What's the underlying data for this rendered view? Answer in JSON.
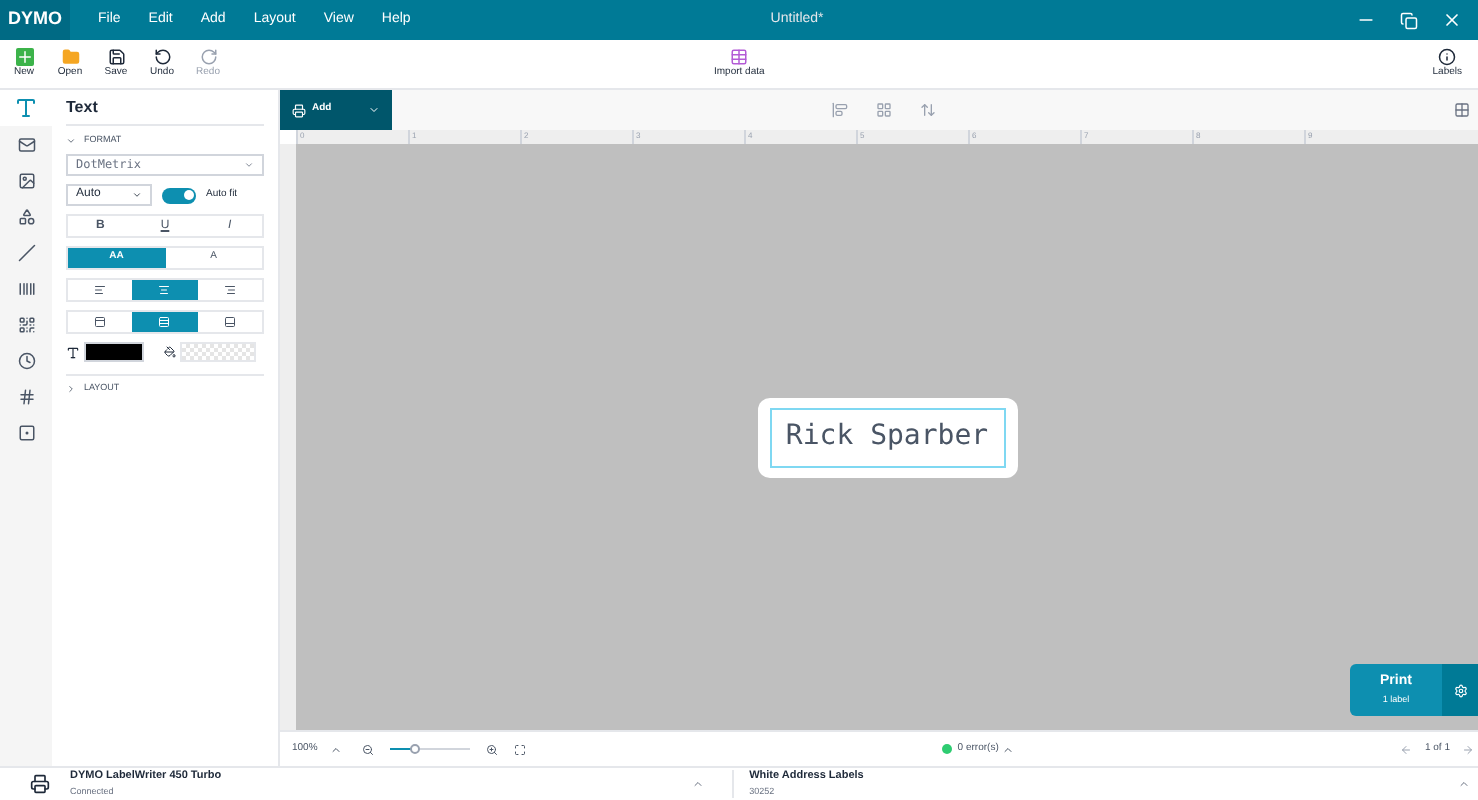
{
  "titlebar": {
    "logo": "DYMO",
    "menu": [
      "File",
      "Edit",
      "Add",
      "Layout",
      "View",
      "Help"
    ],
    "title": "Untitled*"
  },
  "toolbar": {
    "left": [
      {
        "kind": "new",
        "label": "New",
        "disabled": false
      },
      {
        "kind": "open",
        "label": "Open",
        "disabled": false
      },
      {
        "kind": "save",
        "label": "Save",
        "disabled": false
      },
      {
        "kind": "undo",
        "label": "Undo",
        "disabled": false
      },
      {
        "kind": "redo",
        "label": "Redo",
        "disabled": true
      }
    ],
    "import": "Import data",
    "labels": "Labels"
  },
  "tools": [
    {
      "kind": "text",
      "selected": true
    },
    {
      "kind": "address",
      "selected": false
    },
    {
      "kind": "image",
      "selected": false
    },
    {
      "kind": "shape",
      "selected": false
    },
    {
      "kind": "line",
      "selected": false
    },
    {
      "kind": "barcode",
      "selected": false
    },
    {
      "kind": "qr",
      "selected": false
    },
    {
      "kind": "clock",
      "selected": false
    },
    {
      "kind": "counter",
      "selected": false
    },
    {
      "kind": "frame",
      "selected": false
    }
  ],
  "panel": {
    "title": "Text",
    "format_section": {
      "label": "FORMAT",
      "expanded": true
    },
    "font": "DotMetrix",
    "size": "Auto",
    "autofit": {
      "label": "Auto fit",
      "on": true
    },
    "style_buttons": [
      {
        "label": "B",
        "kind": "bold",
        "selected": false
      },
      {
        "label": "U",
        "kind": "underline",
        "selected": false
      },
      {
        "label": "I",
        "kind": "italic",
        "selected": false
      }
    ],
    "case_buttons": [
      {
        "label": "AA",
        "kind": "upper",
        "selected": true
      },
      {
        "label": "A",
        "kind": "vertical",
        "selected": false
      }
    ],
    "halign": [
      {
        "kind": "left",
        "selected": false
      },
      {
        "kind": "center",
        "selected": true
      },
      {
        "kind": "right",
        "selected": false
      }
    ],
    "valign": [
      {
        "kind": "top",
        "selected": false
      },
      {
        "kind": "middle",
        "selected": true
      },
      {
        "kind": "bottom",
        "selected": false
      }
    ],
    "layout_section": {
      "label": "LAYOUT",
      "expanded": false
    }
  },
  "canvas": {
    "add_button": "Add",
    "label_text": "Rick Sparber",
    "ruler": [
      "0",
      "1",
      "2",
      "3",
      "4",
      "5",
      "6",
      "7",
      "8",
      "9"
    ]
  },
  "canvas_footer": {
    "zoom": "100%",
    "zoom_slider": {
      "level": 0.3
    },
    "errors": "0 error(s)",
    "pages": "1 of 1"
  },
  "print": {
    "label": "Print",
    "count": "1 label"
  },
  "status": {
    "printer": "DYMO LabelWriter 450 Turbo",
    "printer_state": "Connected",
    "label_type": "White Address Labels",
    "label_code": "30252"
  }
}
